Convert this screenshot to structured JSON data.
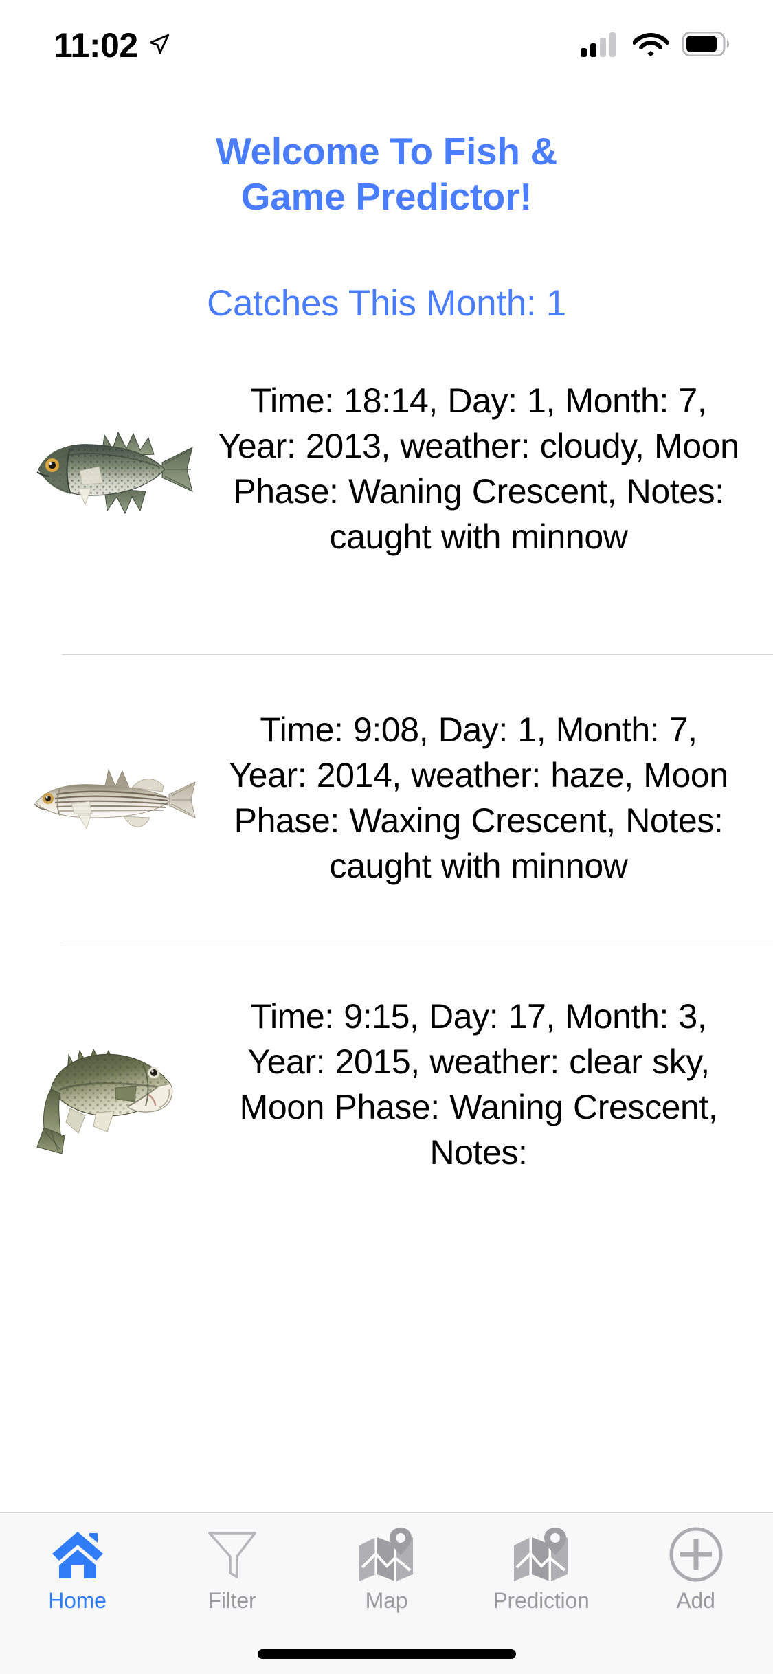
{
  "status_bar": {
    "time": "11:02",
    "location_icon": "location-arrow-icon",
    "signal_icon": "cellular-signal-icon",
    "wifi_icon": "wifi-icon",
    "battery_icon": "battery-icon"
  },
  "header": {
    "title_line1": "Welcome To Fish &",
    "title_line2": "Game Predictor!",
    "title_color": "#4a7dfc",
    "catch_count_label": "Catches This Month: 1"
  },
  "catches": [
    {
      "fish": "black-crappie",
      "text": "Time: 18:14, Day: 1, Month: 7, Year: 2013, weather: cloudy, Moon Phase: Waning Crescent, Notes: caught with minnow",
      "time": "18:14",
      "day": "1",
      "month": "7",
      "year": "2013",
      "weather": "cloudy",
      "moon_phase": "Waning Crescent",
      "notes": "caught with minnow"
    },
    {
      "fish": "striped-bass",
      "text": "Time: 9:08, Day: 1, Month: 7, Year: 2014, weather: haze, Moon Phase: Waxing Crescent, Notes: caught with minnow",
      "time": "9:08",
      "day": "1",
      "month": "7",
      "year": "2014",
      "weather": "haze",
      "moon_phase": "Waxing Crescent",
      "notes": "caught with minnow"
    },
    {
      "fish": "largemouth-bass",
      "text": "Time: 9:15, Day: 17, Month: 3, Year: 2015, weather: clear sky, Moon Phase: Waning Crescent, Notes:",
      "time": "9:15",
      "day": "17",
      "month": "3",
      "year": "2015",
      "weather": "clear sky",
      "moon_phase": "Waning Crescent",
      "notes": ""
    }
  ],
  "tabbar": {
    "active_color": "#2f7cf6",
    "inactive_color": "#9a9a9f",
    "items": [
      {
        "label": "Home",
        "icon": "home-icon",
        "active": true
      },
      {
        "label": "Filter",
        "icon": "funnel-icon",
        "active": false
      },
      {
        "label": "Map",
        "icon": "map-pin-icon",
        "active": false
      },
      {
        "label": "Prediction",
        "icon": "map-pin-icon",
        "active": false
      },
      {
        "label": "Add",
        "icon": "plus-circle-icon",
        "active": false
      }
    ]
  }
}
